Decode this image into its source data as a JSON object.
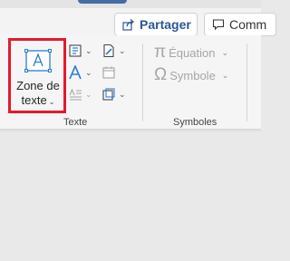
{
  "actions": {
    "share_label": "Partager",
    "comment_label": "Comm"
  },
  "text_group": {
    "text_box_line1": "Zone de",
    "text_box_line2": "texte",
    "group_label": "Texte"
  },
  "symbols_group": {
    "equation_label": "Équation",
    "symbol_label": "Symbole",
    "group_label": "Symboles"
  },
  "icons": {
    "share": "share-arrow-icon",
    "comment": "comment-icon",
    "text_box": "text-box-icon",
    "quick_parts": "quick-parts-icon",
    "wordart": "wordart-icon",
    "drop_cap": "drop-cap-icon",
    "signature": "signature-line-icon",
    "date_time": "date-time-icon",
    "object": "object-icon",
    "equation": "pi-icon",
    "symbol": "omega-icon"
  },
  "colors": {
    "highlight": "#e8182b",
    "accent_blue": "#2b579a",
    "disabled_text": "#a6a6a6"
  }
}
